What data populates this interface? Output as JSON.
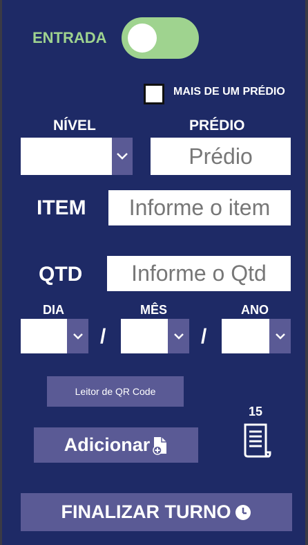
{
  "toggle": {
    "label": "ENTRADA",
    "on": true
  },
  "multi_building": {
    "label": "MAIS DE UM PRÉDIO",
    "checked": false
  },
  "nivel": {
    "label": "NÍVEL",
    "value": ""
  },
  "predio": {
    "label": "PRÉDIO",
    "placeholder": "Prédio"
  },
  "item": {
    "label": "ITEM",
    "placeholder": "Informe o item"
  },
  "qtd": {
    "label": "QTD",
    "placeholder": "Informe o Qtd"
  },
  "date": {
    "day_label": "DIA",
    "month_label": "MÊS",
    "year_label": "ANO",
    "separator": "/"
  },
  "qr_button": {
    "label": "Leitor de QR Code"
  },
  "add_button": {
    "label": "Adicionar"
  },
  "item_count": "15",
  "finish_button": {
    "label": "FINALIZAR TURNO"
  },
  "colors": {
    "background": "#1e2a66",
    "button": "#5a5a95",
    "toggle": "#9fd38f"
  },
  "icons": {
    "add": "file-plus-icon",
    "count": "receipt-icon",
    "finish": "clock-icon",
    "dropdown": "chevron-down-icon"
  }
}
